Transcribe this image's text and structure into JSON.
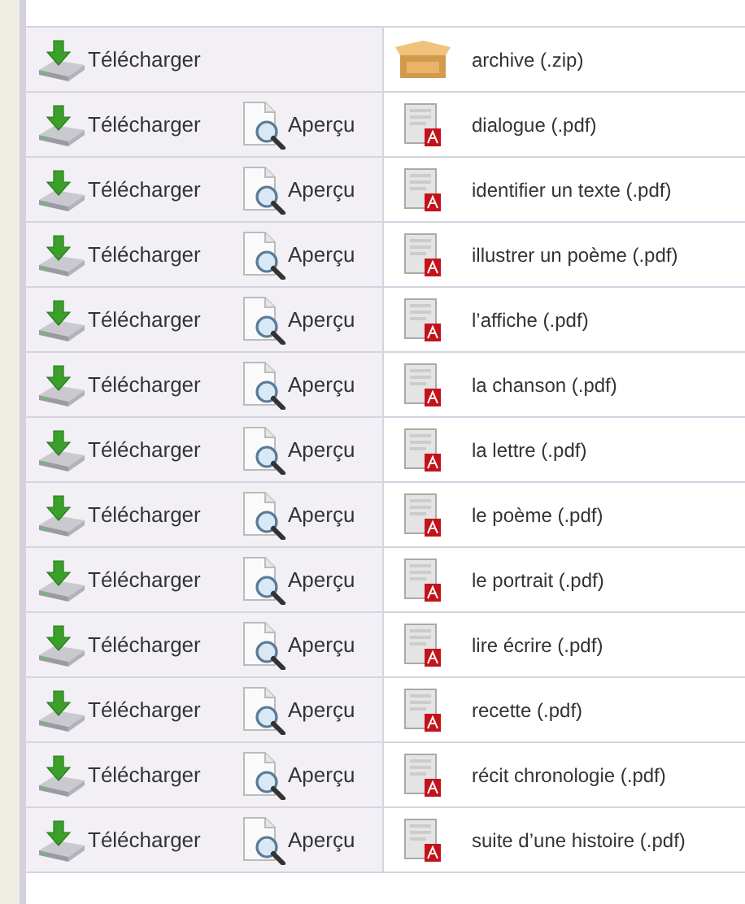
{
  "files": [
    {
      "kind": "zip",
      "download": "Télécharger",
      "name": "archive (.zip)"
    },
    {
      "kind": "pdf",
      "download": "Télécharger",
      "preview": "Aperçu",
      "name": "dialogue (.pdf)"
    },
    {
      "kind": "pdf",
      "download": "Télécharger",
      "preview": "Aperçu",
      "name": "identifier un texte (.pdf)"
    },
    {
      "kind": "pdf",
      "download": "Télécharger",
      "preview": "Aperçu",
      "name": "illustrer un poème (.pdf)"
    },
    {
      "kind": "pdf",
      "download": "Télécharger",
      "preview": "Aperçu",
      "name": "l’affiche (.pdf)"
    },
    {
      "kind": "pdf",
      "download": "Télécharger",
      "preview": "Aperçu",
      "name": "la chanson (.pdf)"
    },
    {
      "kind": "pdf",
      "download": "Télécharger",
      "preview": "Aperçu",
      "name": "la lettre (.pdf)"
    },
    {
      "kind": "pdf",
      "download": "Télécharger",
      "preview": "Aperçu",
      "name": "le poème (.pdf)"
    },
    {
      "kind": "pdf",
      "download": "Télécharger",
      "preview": "Aperçu",
      "name": "le portrait (.pdf)"
    },
    {
      "kind": "pdf",
      "download": "Télécharger",
      "preview": "Aperçu",
      "name": "lire écrire (.pdf)"
    },
    {
      "kind": "pdf",
      "download": "Télécharger",
      "preview": "Aperçu",
      "name": "recette (.pdf)"
    },
    {
      "kind": "pdf",
      "download": "Télécharger",
      "preview": "Aperçu",
      "name": "récit chronologie (.pdf)"
    },
    {
      "kind": "pdf",
      "download": "Télécharger",
      "preview": "Aperçu",
      "name": "suite d’une histoire (.pdf)"
    }
  ]
}
